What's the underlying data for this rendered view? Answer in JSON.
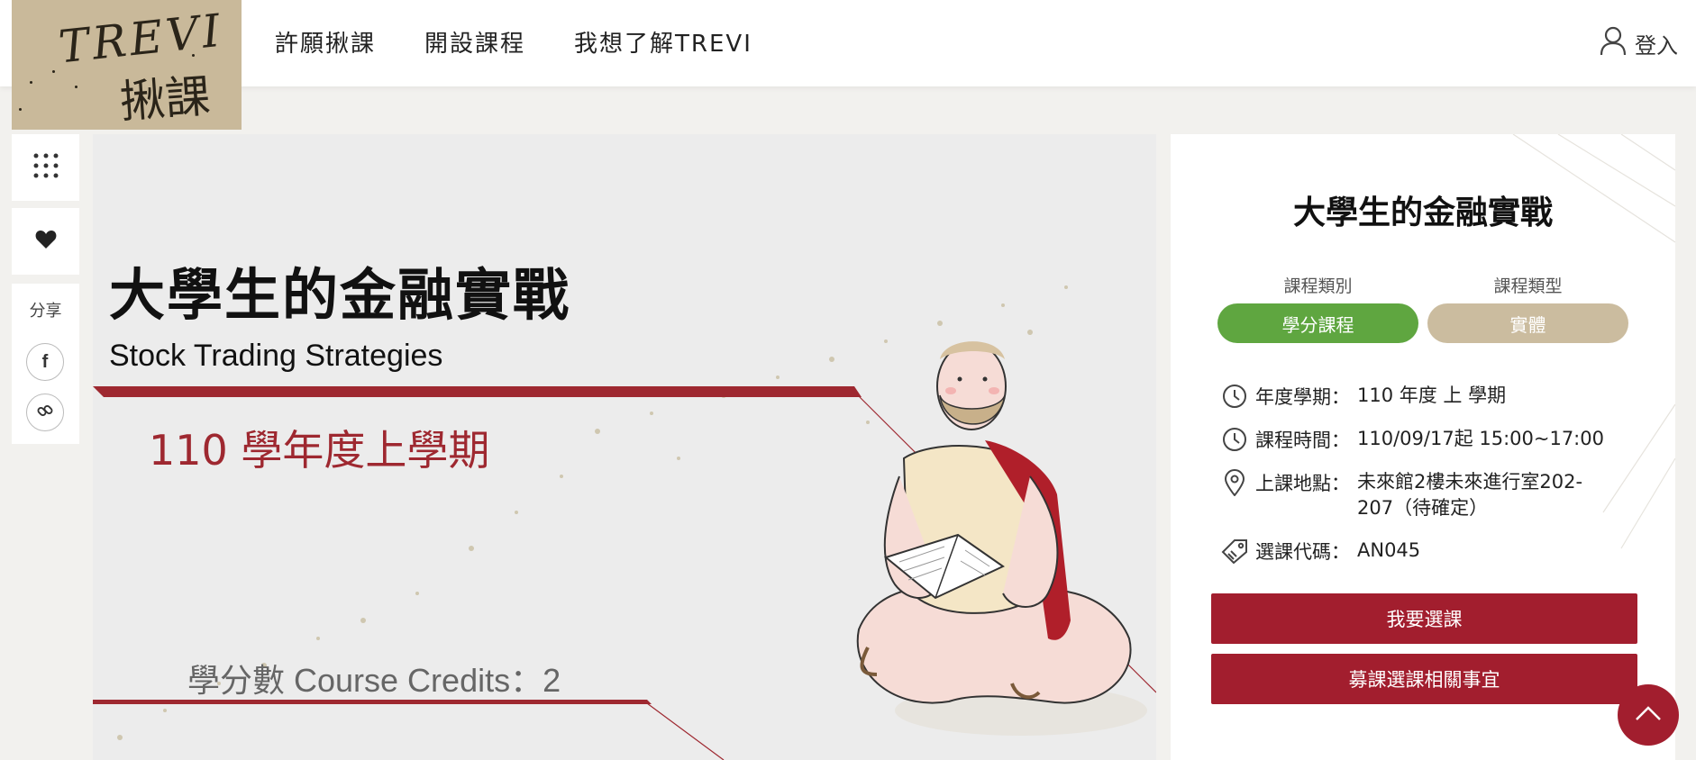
{
  "header": {
    "logo": {
      "line1": "TREVI",
      "line2": "揪課"
    },
    "nav": [
      "許願揪課",
      "開設課程",
      "我想了解TREVI"
    ],
    "login_label": "登入"
  },
  "rail": {
    "share_label": "分享",
    "facebook_glyph": "f"
  },
  "banner": {
    "title": "大學生的金融實戰",
    "subtitle": "Stock Trading Strategies",
    "term": "110 學年度上學期",
    "credits": "學分數 Course Credits：2"
  },
  "card": {
    "title": "大學生的金融實戰",
    "category_label": "課程類別",
    "category_value": "學分課程",
    "type_label": "課程類型",
    "type_value": "實體",
    "rows": [
      {
        "icon": "clock-icon",
        "label": "年度學期：",
        "value": "110 年度 上 學期"
      },
      {
        "icon": "clock-icon",
        "label": "課程時間：",
        "value": "110/09/17起  15:00~17:00"
      },
      {
        "icon": "location-pin-icon",
        "label": "上課地點：",
        "value": "未來館2樓未來進行室202-207（待確定）"
      },
      {
        "icon": "tag-icon",
        "label": "選課代碼：",
        "value": "AN045"
      }
    ],
    "enroll_button": "我要選課",
    "info_button": "募課選課相關事宜"
  },
  "colors": {
    "brand_red": "#a21e2e",
    "green": "#5fa640",
    "beige": "#cbbc9f",
    "logo_bg": "#c9b99a"
  }
}
